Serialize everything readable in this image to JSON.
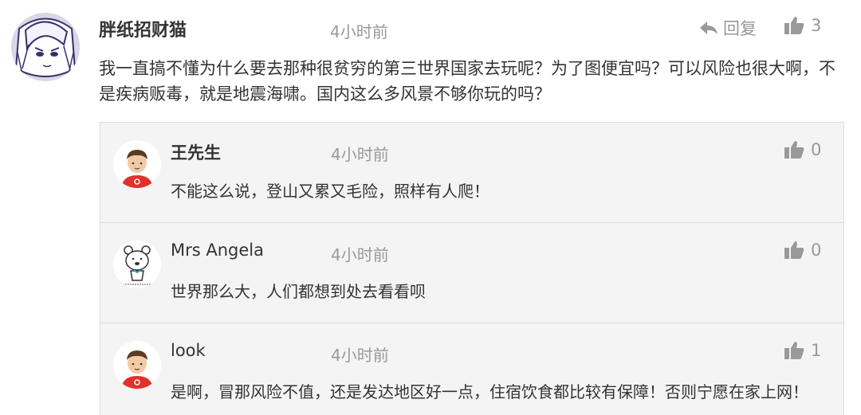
{
  "main_comment": {
    "author": "胖纸招财猫",
    "time": "4小时前",
    "reply_label": "回复",
    "likes": "3",
    "text": "我一直搞不懂为什么要去那种很贫穷的第三世界国家去玩呢？为了图便宜吗？可以风险也很大啊，不是疾病贩毒，就是地震海啸。国内这么多风景不够你玩的吗？"
  },
  "replies": [
    {
      "author": "王先生",
      "time": "4小时前",
      "likes": "0",
      "text": "不能这么说，登山又累又毛险，照样有人爬！"
    },
    {
      "author": "Mrs Angela",
      "time": "4小时前",
      "likes": "0",
      "text": "世界那么大，人们都想到处去看看呗"
    },
    {
      "author": "look",
      "time": "4小时前",
      "likes": "1",
      "text": "是啊，冒那风险不值，还是发达地区好一点，住宿饮食都比较有保障！否则宁愿在家上网！"
    }
  ],
  "colors": {
    "text": "#333333",
    "muted": "#999999",
    "reply_bg": "#f4f4f4",
    "border": "#dddddd",
    "avatar_shirt": "#e0322b"
  }
}
